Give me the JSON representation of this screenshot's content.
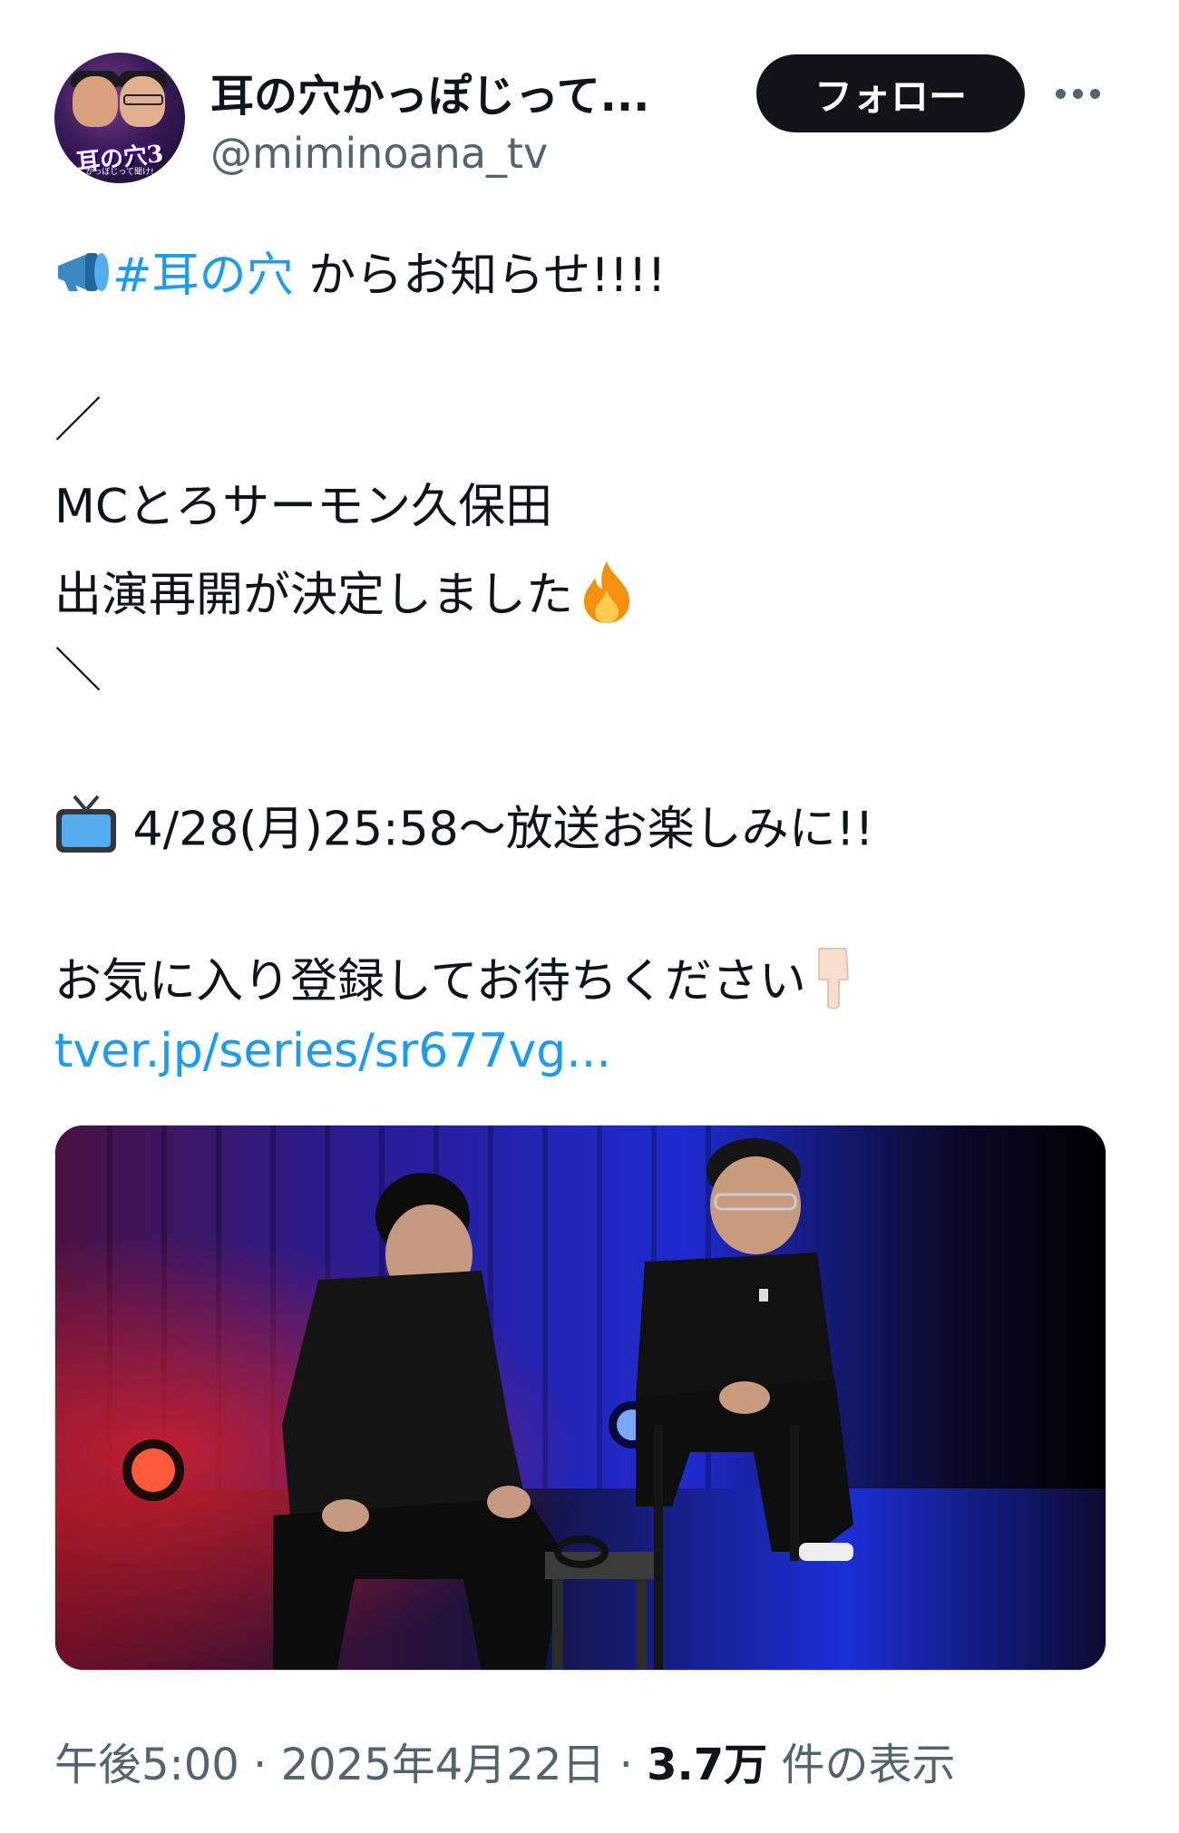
{
  "author": {
    "display_name": "耳の穴かっぽじって...",
    "handle": "@miminoana_tv",
    "avatar_logo": "耳の穴3",
    "avatar_subtitle": "かっぽじって聞け!"
  },
  "follow_label": "フォロー",
  "tweet": {
    "hashtag": "#耳の穴",
    "line1_rest": " からお知らせ!!!!",
    "slash_open": "／",
    "line_mc": " MCとろサーモン久保田",
    "line_resume": " 出演再開が決定しました",
    "slash_close": "＼",
    "broadcast": " 4/28(月)25:58〜放送お楽しみに!!",
    "favorite": "お気に入り登録してお待ちください",
    "link": "tver.jp/series/sr677vg..."
  },
  "meta": {
    "time": "午後5:00",
    "sep": " · ",
    "date": "2025年4月22日",
    "views_count": "3.7万",
    "views_label": " 件の表示"
  },
  "icons": [
    "megaphone-icon",
    "fire-icon",
    "tv-icon",
    "pointing-down-icon",
    "more-icon"
  ]
}
